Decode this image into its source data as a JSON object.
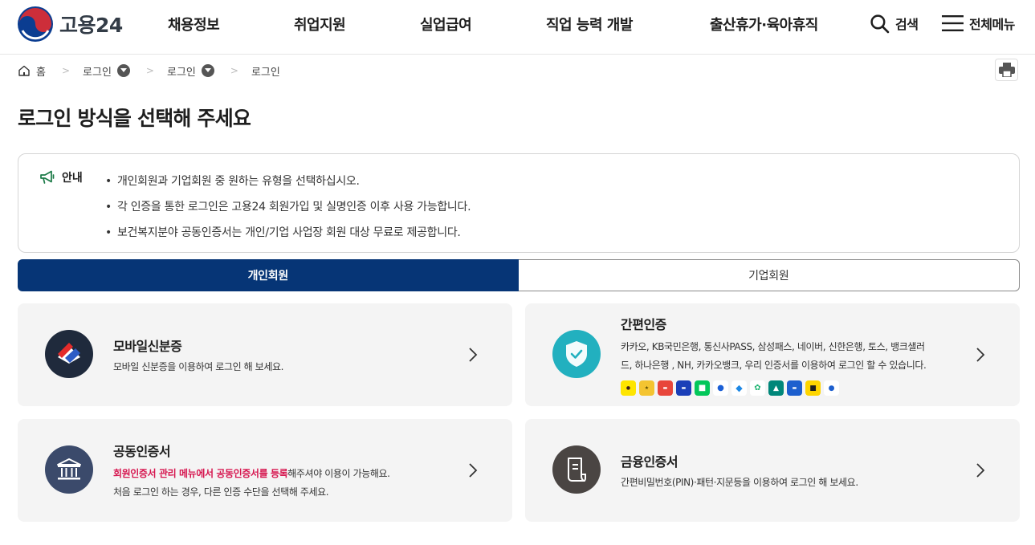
{
  "header": {
    "logo_text": "고용24",
    "nav": [
      {
        "label": "채용정보"
      },
      {
        "label": "취업지원"
      },
      {
        "label": "실업급여"
      },
      {
        "label": "직업 능력 개발"
      },
      {
        "label": "출산휴가·육아휴직"
      }
    ],
    "search_label": "검색",
    "menu_label": "전체메뉴"
  },
  "breadcrumb": {
    "home": "홈",
    "items": [
      "로그인",
      "로그인",
      "로그인"
    ]
  },
  "page_title": "로그인 방식을 선택해 주세요",
  "notice": {
    "title": "안내",
    "items": [
      "개인회원과 기업회원 중 원하는 유형을 선택하십시오.",
      "각 인증을 통한 로그인은 고용24 회원가입 및 실명인증 이후 사용 가능합니다.",
      "보건복지분야 공동인증서는 개인/기업 사업장 회원 대상 무료로 제공합니다."
    ]
  },
  "tabs": [
    {
      "label": "개인회원",
      "active": true
    },
    {
      "label": "기업회원",
      "active": false
    }
  ],
  "cards": {
    "mobile_id": {
      "title": "모바일신분증",
      "desc": "모바일 신분증을 이용하여 로그인 해 보세요."
    },
    "simple_auth": {
      "title": "간편인증",
      "desc_line1": "카카오, KB국민은행, 통신사PASS, 삼성패스, 네이버, 신한은행, 토스, 뱅크샐러",
      "desc_line2": "드, 하나은행 , NH, 카카오뱅크, 우리 인증서를 이용하여 로그인 할 수 있습니다.",
      "services": [
        {
          "name": "kakao-icon",
          "color": "#fee500"
        },
        {
          "name": "kb-bank-icon",
          "color": "#f4c431"
        },
        {
          "name": "pass-icon",
          "color": "#e8463b"
        },
        {
          "name": "samsung-pass-icon",
          "color": "#1b3fb8"
        },
        {
          "name": "naver-icon",
          "color": "#03c75a"
        },
        {
          "name": "shinhan-bank-icon",
          "color": "#ffffff"
        },
        {
          "name": "toss-icon",
          "color": "#ffffff"
        },
        {
          "name": "banksalad-icon",
          "color": "#ffffff"
        },
        {
          "name": "hana-bank-icon",
          "color": "#00877a"
        },
        {
          "name": "nh-icon",
          "color": "#1d5fce"
        },
        {
          "name": "kakao-bank-icon",
          "color": "#fed500"
        },
        {
          "name": "woori-bank-icon",
          "color": "#ffffff"
        }
      ]
    },
    "joint_cert": {
      "title": "공동인증서",
      "desc_highlight": "회원인증서 관리 메뉴에서 공동인증서를 등록",
      "desc_rest": "해주셔야 이용이 가능해요.",
      "desc_line2": "처음 로그인 하는 경우, 다른 인증 수단을 선택해 주세요."
    },
    "financial_cert": {
      "title": "금융인증서",
      "desc": "간편비밀번호(PIN)·패턴·지문등을 이용하여 로그인 해 보세요."
    }
  },
  "colors": {
    "primary": "#063576",
    "highlight": "#d6164f",
    "card_bg": "#f4f4f4"
  }
}
